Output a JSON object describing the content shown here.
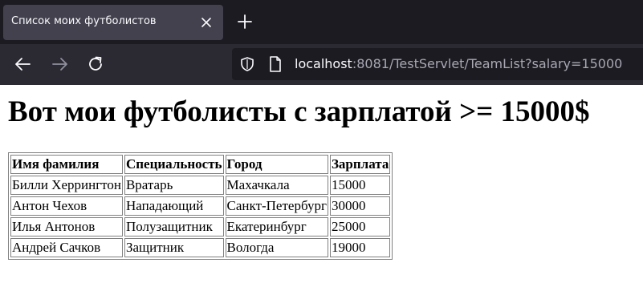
{
  "browser": {
    "tab": {
      "title": "Список моих футболистов",
      "close_icon": "close-icon"
    },
    "new_tab_icon": "plus-icon",
    "nav": {
      "back_icon": "arrow-left-icon",
      "forward_icon": "arrow-right-icon",
      "reload_icon": "reload-icon"
    },
    "url": {
      "host": "localhost",
      "rest": ":8081/TestServlet/TeamList?salary=15000"
    },
    "colors": {
      "tabstrip": "#1c1b22",
      "active_tab": "#42414d",
      "navbar": "#2b2a33",
      "urlbar": "#1c1b22"
    }
  },
  "page": {
    "title": "Вот мои футболисты с зарплатой >= 15000$",
    "table": {
      "headers": [
        "Имя фамилия",
        "Специальность",
        "Город",
        "Зарплата"
      ],
      "rows": [
        [
          "Билли Херрингтон",
          "Вратарь",
          "Махачкала",
          "15000"
        ],
        [
          "Антон Чехов",
          "Нападающий",
          "Санкт-Петербург",
          "30000"
        ],
        [
          "Илья Антонов",
          "Полузащитник",
          "Екатеринбург",
          "25000"
        ],
        [
          "Андрей Сачков",
          "Защитник",
          "Вологда",
          "19000"
        ]
      ]
    }
  }
}
